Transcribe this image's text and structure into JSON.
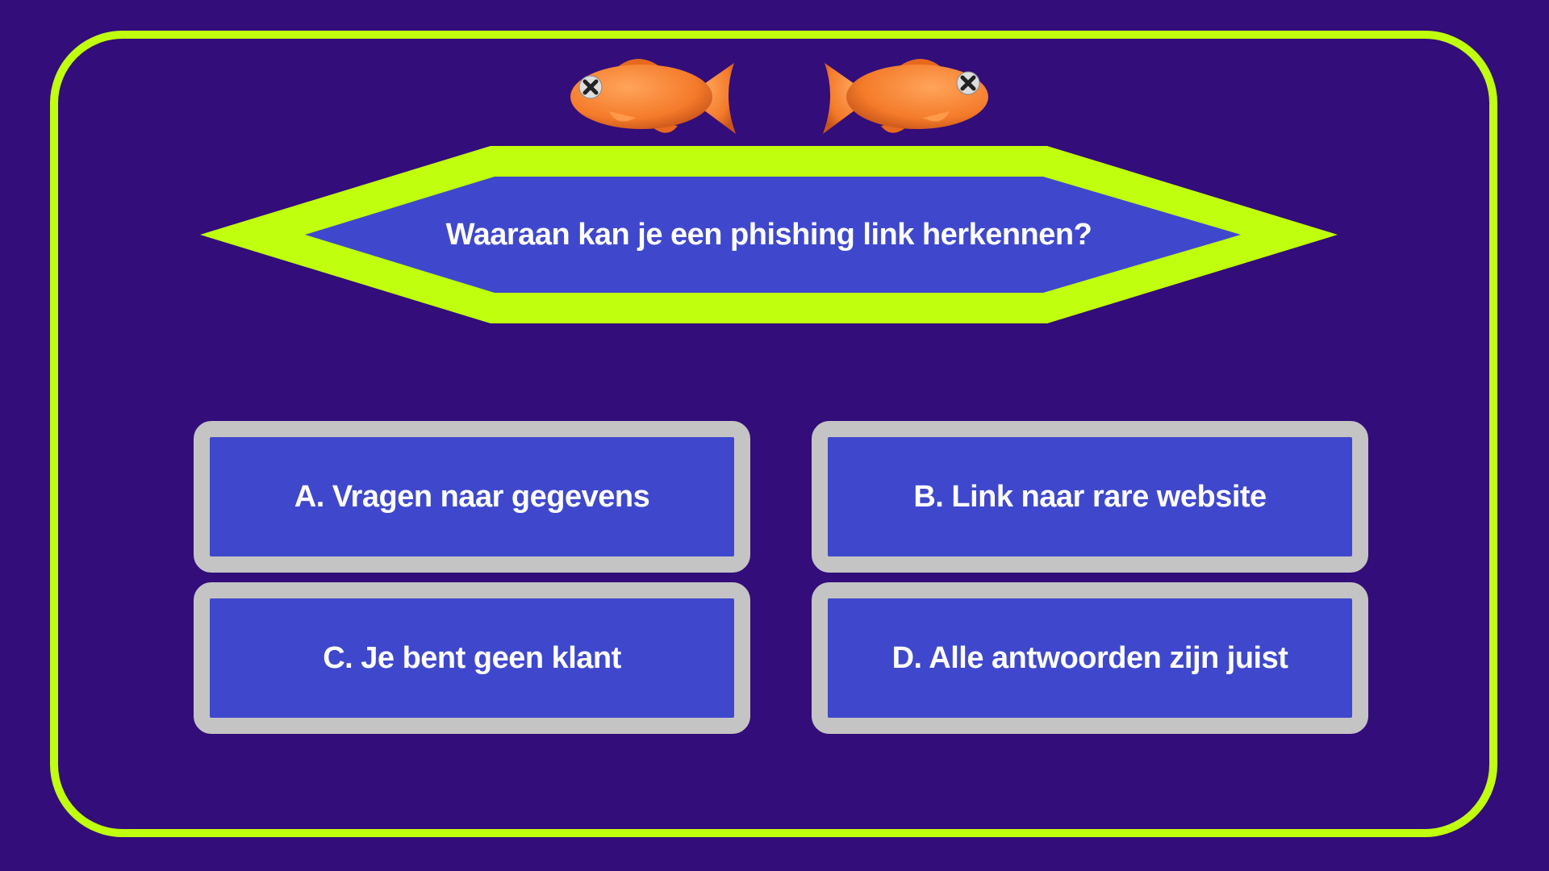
{
  "quiz": {
    "question": "Waaraan kan je een phishing link herkennen?",
    "answers": [
      {
        "label": "A. Vragen naar gegevens"
      },
      {
        "label": "B. Link naar rare website"
      },
      {
        "label": "C. Je bent geen klant"
      },
      {
        "label": "D. Alle antwoorden zijn juist"
      }
    ]
  },
  "lifelines": [
    {
      "icon": "dead-fish-icon",
      "facing": "left"
    },
    {
      "icon": "dead-fish-icon",
      "facing": "right"
    }
  ],
  "colors": {
    "background": "#330d7a",
    "frame_accent": "#c0ff0e",
    "box_fill": "#3f48cc",
    "answer_border": "#c4c4c4",
    "fish": "#f47b2a",
    "text": "#ffffff"
  }
}
